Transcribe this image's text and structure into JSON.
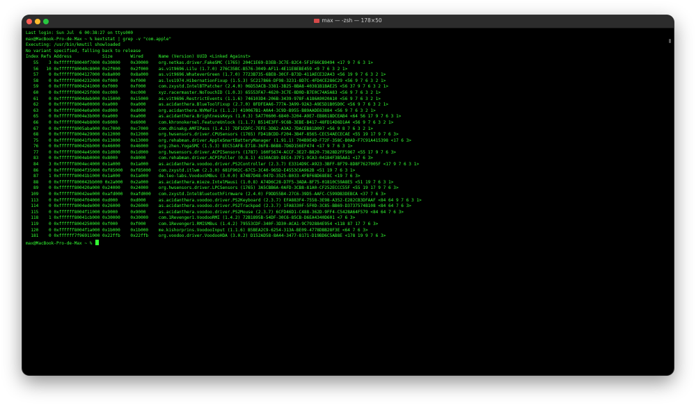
{
  "window": {
    "title": "max — -zsh — 178×50"
  },
  "terminal": {
    "lines": [
      "Last login: Sun Jul  6 00:38:27 on ttys000",
      "max@MacBook-Pro-de-Max ~ % kextstat | grep -v \"com.apple\"",
      "Executing: /usr/bin/kmutil showloaded",
      "No variant specified, falling back to release",
      "Index Refs Address            Size       Wired      Name (Version) UUID <Linked Against>",
      "   55    3 0xffffff80040f7000 0x30000    0x30000    org.netkas.driver.FakeSMC (1765) 204C1E69-D3EB-3C7E-82C4-5F1F66CB9494 <17 9 7 6 3 1>",
      "   56   10 0xffffff80040c8000 0x2f000    0x2f000    as.vit9696.Lilu (1.7.0) 276C35BC-B576-3049-AF11-4E11E8EBE459 <9 7 6 3 2 1>",
      "   57    0 0xffffff8004127000 0x8a000    0x8a000    as.vit9696.WhateverGreen (1.7.0) 7723B735-6BE8-30CF-B73D-411AECE32A43 <56 19 9 7 6 3 2 1>",
      "   58    0 0xffffff8004232000 0xf000     0xf000     as.lvs1974.HibernationFixup (1.5.3) 5C217866-DF98-3231-8D7C-4FD4CE286C29 <56 9 7 6 3 2 1>",
      "   59    0 0xffffff8004241000 0xf000     0xf000     com.zxystd.IntelBTPatcher (2.4.0) 06D53ACB-3381-3B25-8BA8-40381B1BAE25 <56 37 9 7 6 3 2 1>",
      "   60    0 0xffffff800425f000 0xc000     0xc000     xyz.racermaster.NoTouchID (1.0.3) 65553FA7-4620-3C7E-8D0D-B7E0C74A5A83 <56 9 7 6 3 2 1>",
      "   61    0 0xffffff8004deb000 0x15000    0x15000    as.vit9696.RestrictEvents (1.1.6) 746103D4-206B-3439-978F-A186A9020A10 <56 9 7 6 3 2 1>",
      "   62    0 0xffffff8004e00000 0xa000     0xa000     as.acidanthera.BlueToolFixup (2.7.0) 8FDFEAA6-777A-3A99-92A3-A9E5D1B05D0C <56 9 7 6 3 2 1>",
      "   63    0 0xffffff8004e0a000 0xd000     0xd000     org.acidanthera.NVMeFix (1.1.2) 410067B1-A0A4-3C9D-B955-B89AADE63884 <56 9 7 6 3 2 1>",
      "   65    0 0xffffff8004e3b000 0xa000     0xa000     as.acidanthera.BrightnessKeys (1.0.3) 5A770600-6840-3204-A9E7-EB8618DCEAB4 <64 56 17 9 7 6 3 1>",
      "   66    0 0xffffff8004eb8000 0x6000     0x6000     com.khronokernel.FeatureUnlock (1.1.7) B514E3FF-9C6B-3EBE-B417-48FD14D6D1A4 <56 9 7 6 3 2 1>",
      "   67    0 0xffffff8005aba000 0xc7000    0xc7000    com.dhinakg.AMFIPass (1.4.1) 7DF1CDFC-7EFE-3D82-A3A2-7DACEB81D097 <56 9 8 7 6 3 2 1>",
      "   68    0 0xffffff8004e29000 0x12000    0x12000    org.hwsensors.driver.CPUSensors (1765) FD41BCDD-F204-3B4F-8565-CEC54AECECAE <55 19 17 9 7 6 3>",
      "   75    0 0xffffff80041fb000 0x13000    0x13000    org.rehabman.driver.AppleSmartBatteryManager (1.91.1) 704B9E4D-F72F-358C-B0AD-F7C91A415398 <17 6 3>",
      "   76    0 0xffffff800426b000 0x46000    0x46000    org.zhen.YogaSMC (1.5.3) EEC51AF8-E718-36F8-B6B8-7D6D156EF474 <17 9 7 6 3 1>",
      "   77    0 0xffffff8004e45000 0x1d000    0x1d000    org.hwsensors.driver.ACPISensors (1787) 160F5674-ACCF-3E27-B820-73828D2FF5967 <55 17 9 7 6 3>",
      "   83    0 0xffffff8004eb0000 0x8000     0x8000     com.rehabman.driver.ACPIPoller (0.8.1) 4150AC89-DEC4-37F1-9CA3-04184F3B5AA1 <17 6 3>",
      "   84    3 0xffffff8004ec4000 0x1a000    0x1a000    as.acidanthera.voodoo.driver.PS2Controller (2.3.7) E3314D9C-A923-3BFF-8F79-8D8F7627005F <17 9 7 6 3 1>",
      "   86    0 0xffffff8004f35000 0xf85000   0xf85000   com.zxystd.itlwm (2.3.0) 681F902C-67C5-3C40-965D-E4553C6A962B <51 19 7 6 3 1>",
      "   87    1 0xffffff80041b1000 0x1a000    0x1a000    de.leo-labs.VoodooSMBus (3.0.0) 874B7D48-047D-3525-B033-4FBF68D68E8C <19 7 6 3>",
      "   88    0 0xffffff800042bb000 0x2a000   0x2a000    as.acidanthera.mieze.IntelMausi (1.0.8) A74D6C28-D7F5-3ADA-8F75-01810C59A8E5 <51 19 7 6 3 1>",
      "   89    0 0xffffff800420a000 0x24000    0x24000    org.hwsensors.driver.LPCSensors (1765) 3A5CBB6A-0AFD-3CB8-81A0-CF252ECCC55F <55 19 17 9 7 6 3>",
      "  109    0 0xffffff80042ee000 0xafd000   0xafd000   com.zxystd.IntelBluetoothFirmware (2.4.0) F9DD55B4-27C6-39D5-AAFC-C599DB3DEBCA <37 7 6 3>",
      "  113    0 0xffffff8004f04000 0xd000     0xd000     as.acidanthera.voodoo.driver.PS2Keyboard (2.3.7) EFA883F4-7558-3E98-A352-E282CB3DFAAF <84 64 9 7 6 3 1>",
      "  114    0 0xffffff8004ede000 0x26000    0x26000    as.acidanthera.voodoo.driver.PS2Trackpad (2.3.7) 1FA8330F-5F0D-3C85-BB69-D3737574B108 <84 64 7 6 3>",
      "  115    0 0xffffff8004f11000 0x9000     0x9000     as.acidanthera.voodoo.driver.PS2Mouse (2.3.7) 6CFD46D1-C488-362D-9FF4-C5428A64F579 <84 64 7 6 3>",
      "  118    1 0xffffff80041cb000 0x30000    0x30000    com.1Revenger1.VoodooRMI (1.4.2) 72B1895B-54DF-30C6-85CB-D6EA4340D601 <7 6 3>",
      "  119    0 0xffffff8004250000 0xf000     0xf000     com.1Revenger1.RMISMBus (1.4.2) 79553CDF-340F-3D30-ACA1-9C792884E954 <118 87 17 7 6 3>",
      "  120    0 0xffffff8004f1a000 0x1b000    0x1b000    me.kishorprins.VoodooInput (1.1.6) B5BEA2C9-6254-313A-BE09-4778DBB28F3E <64 7 6 3>",
      "  181    0 0xffffff7f96911000 0x22ffb    0x22ffb    org.voodoo.driver.VoodooHDA (3.0.2) D152AD58-8A44-3477-8171-D19BD6C5AB8E <178 19 9 7 6 3>"
    ],
    "prompt": "max@MacBook-Pro-de-Max ~ % "
  },
  "colors": {
    "terminal_text": "#33ff33",
    "terminal_background": "#000000"
  }
}
